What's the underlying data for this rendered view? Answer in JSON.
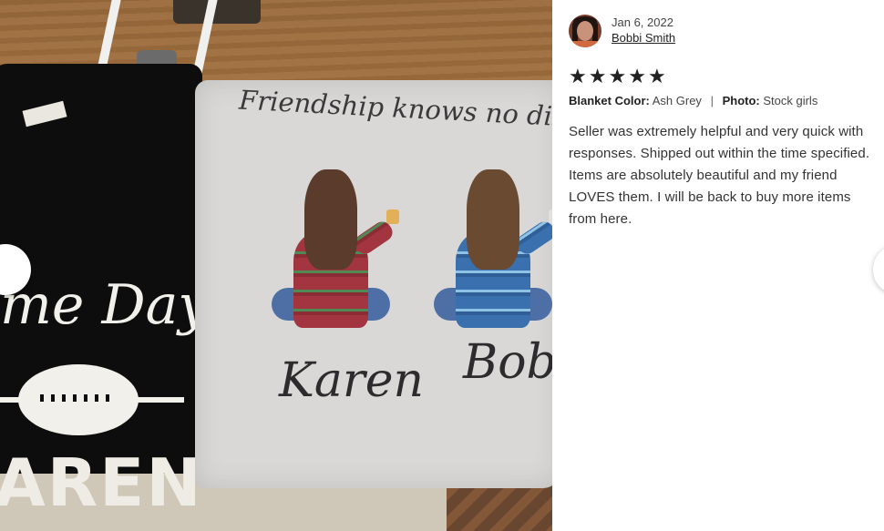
{
  "photo": {
    "blanket_headline": "Friendship knows no distance",
    "shirt_script": "me Day",
    "shirt_name": "AREN",
    "name_left": "Karen",
    "name_right": "Bobb"
  },
  "review": {
    "date": "Jan 6, 2022",
    "reviewer": "Bobbi Smith",
    "rating": 5,
    "stars": [
      "★",
      "★",
      "★",
      "★",
      "★"
    ],
    "attributes": {
      "blanket_label": "Blanket Color:",
      "blanket_value": "Ash Grey",
      "separator": "|",
      "photo_label": "Photo:",
      "photo_value": "Stock girls"
    },
    "text": "Seller was extremely helpful and very quick with responses. Shipped out within the time specified. Items are absolutely beautiful and my friend LOVES them. I will be back to buy more items from here."
  },
  "icons": {
    "star": "star-icon",
    "prev": "chevron-left-icon",
    "next": "chevron-right-icon"
  }
}
